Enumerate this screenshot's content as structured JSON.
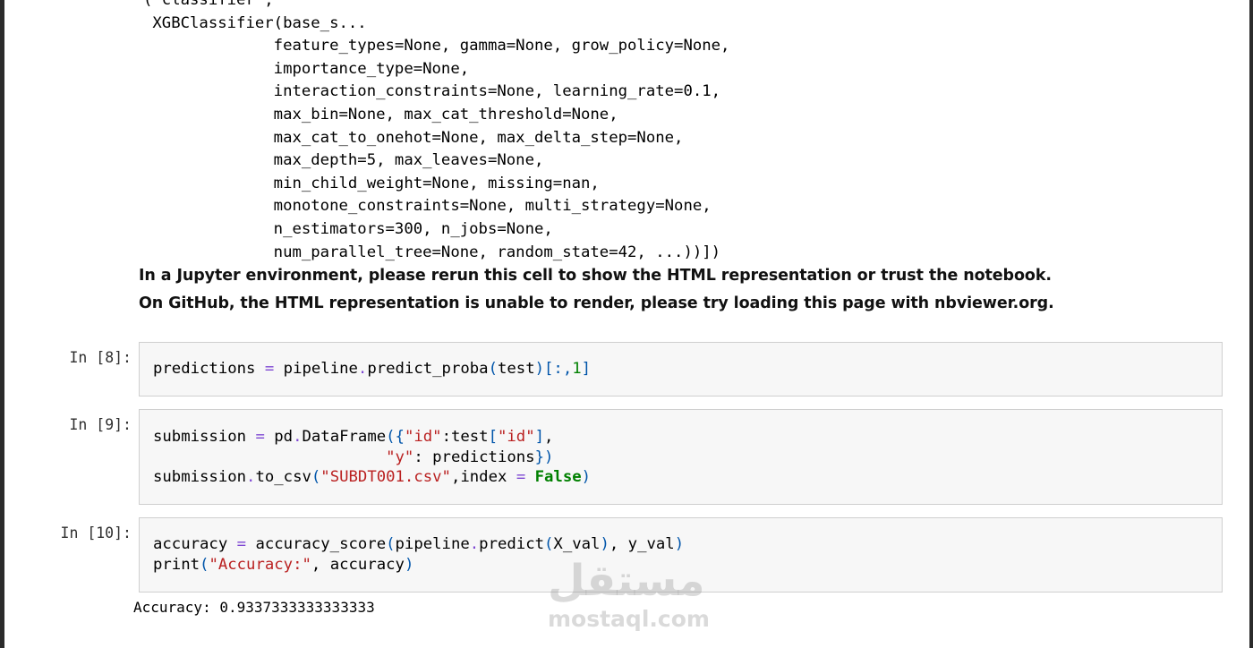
{
  "previous_output": {
    "lines": [
      "('classifier',",
      " XGBClassifier(base_s...",
      "              feature_types=None, gamma=None, grow_policy=None,",
      "              importance_type=None,",
      "              interaction_constraints=None, learning_rate=0.1,",
      "              max_bin=None, max_cat_threshold=None,",
      "              max_cat_to_onehot=None, max_delta_step=None,",
      "              max_depth=5, max_leaves=None,",
      "              min_child_weight=None, missing=nan,",
      "              monotone_constraints=None, multi_strategy=None,",
      "              n_estimators=300, n_jobs=None,",
      "              num_parallel_tree=None, random_state=42, ...))])"
    ],
    "warning_line1": "In a Jupyter environment, please rerun this cell to show the HTML representation or trust the notebook.",
    "warning_line2": "On GitHub, the HTML representation is unable to render, please try loading this page with nbviewer.org."
  },
  "cells": [
    {
      "prompt": "In [8]:",
      "code_lines": [
        "predictions = pipeline.predict_proba(test)[:,1]"
      ]
    },
    {
      "prompt": "In [9]:",
      "code_lines": [
        "submission = pd.DataFrame({\"id\":test[\"id\"],",
        "                         \"y\": predictions})",
        "submission.to_csv(\"SUBDT001.csv\",index = False)"
      ]
    },
    {
      "prompt": "In [10]:",
      "code_lines": [
        "accuracy = accuracy_score(pipeline.predict(X_val), y_val)",
        "print(\"Accuracy:\", accuracy)"
      ],
      "output": "Accuracy: 0.9337333333333333"
    }
  ],
  "watermark": {
    "arabic": "مستقل",
    "latin": "mostaql.com"
  }
}
